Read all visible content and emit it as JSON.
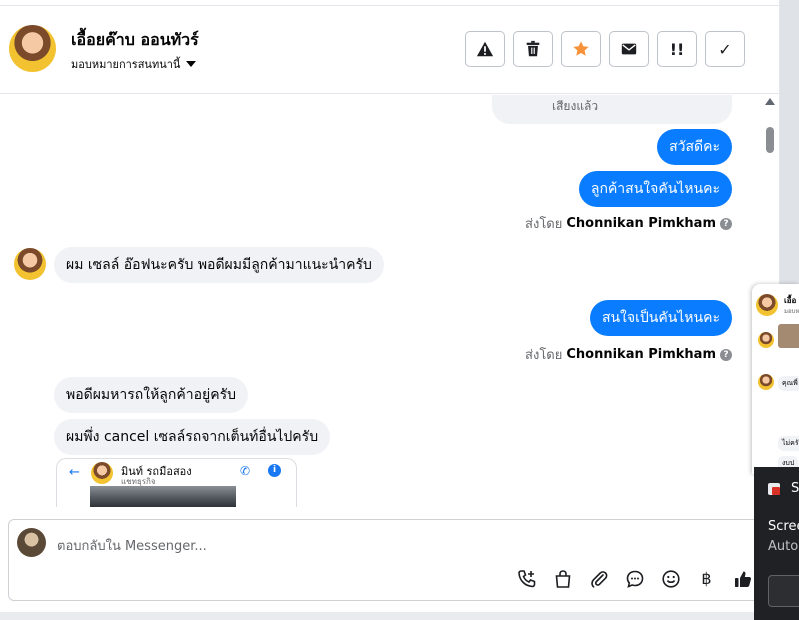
{
  "header": {
    "contact_name": "เอื้อยค๊าบ ออนทัวร์",
    "assign_label": "มอบหมายการสนทนานี้",
    "actions": [
      {
        "icon": "warning-icon",
        "name": "report-spam-button"
      },
      {
        "icon": "trash-icon",
        "name": "delete-button"
      },
      {
        "icon": "star-icon",
        "name": "star-button"
      },
      {
        "icon": "envelope-icon",
        "name": "mark-unread-button"
      },
      {
        "icon": "priority-icon",
        "name": "mark-priority-button",
        "text": "!!"
      },
      {
        "icon": "check-icon",
        "name": "mark-done-button",
        "text": "✓"
      }
    ],
    "star_color": "#f7923b"
  },
  "thread": {
    "partial_text": "เสียงแล้ว",
    "out1": "สวัสดีคะ",
    "out2": "ลูกค้าสนใจคันไหนคะ",
    "sent_by_prefix": "ส่งโดย",
    "sent_by_name": "Chonnikan Pimkham",
    "in1": "ผม เซลล์ อ๊อฟนะครับ พอดีผมมีลูกค้ามาแนะนำครับ",
    "out3": "สนใจเป็นคันไหนคะ",
    "in2": "พอดีผมหารถให้ลูกค้าอยู่ครับ",
    "in3": "ผมพึ่ง cancel เซลล์รถจากเต็นท์อื่นไปครับ",
    "shot_name": "มินท์ รถมือสอง",
    "shot_sub": "แชทธุรกิจ",
    "help_glyph": "?",
    "outgoing_color": "#0a7cff"
  },
  "composer": {
    "placeholder": "ตอบกลับใน Messenger...",
    "tools": [
      "call-add-icon",
      "shopping-bag-icon",
      "paperclip-icon",
      "chat-bubble-icon",
      "smiley-icon",
      "baht-icon",
      "thumbs-up-icon"
    ],
    "baht": "฿"
  },
  "float_chat": {
    "name_fragment": "เอื้อ",
    "sub_fragment": "มอบห",
    "bubble1": "คุณพี่",
    "bubble2": "ไม่ครั",
    "bubble3": "งบป"
  },
  "toast": {
    "app": "S",
    "line1": "Scree",
    "line2": "Auto"
  }
}
